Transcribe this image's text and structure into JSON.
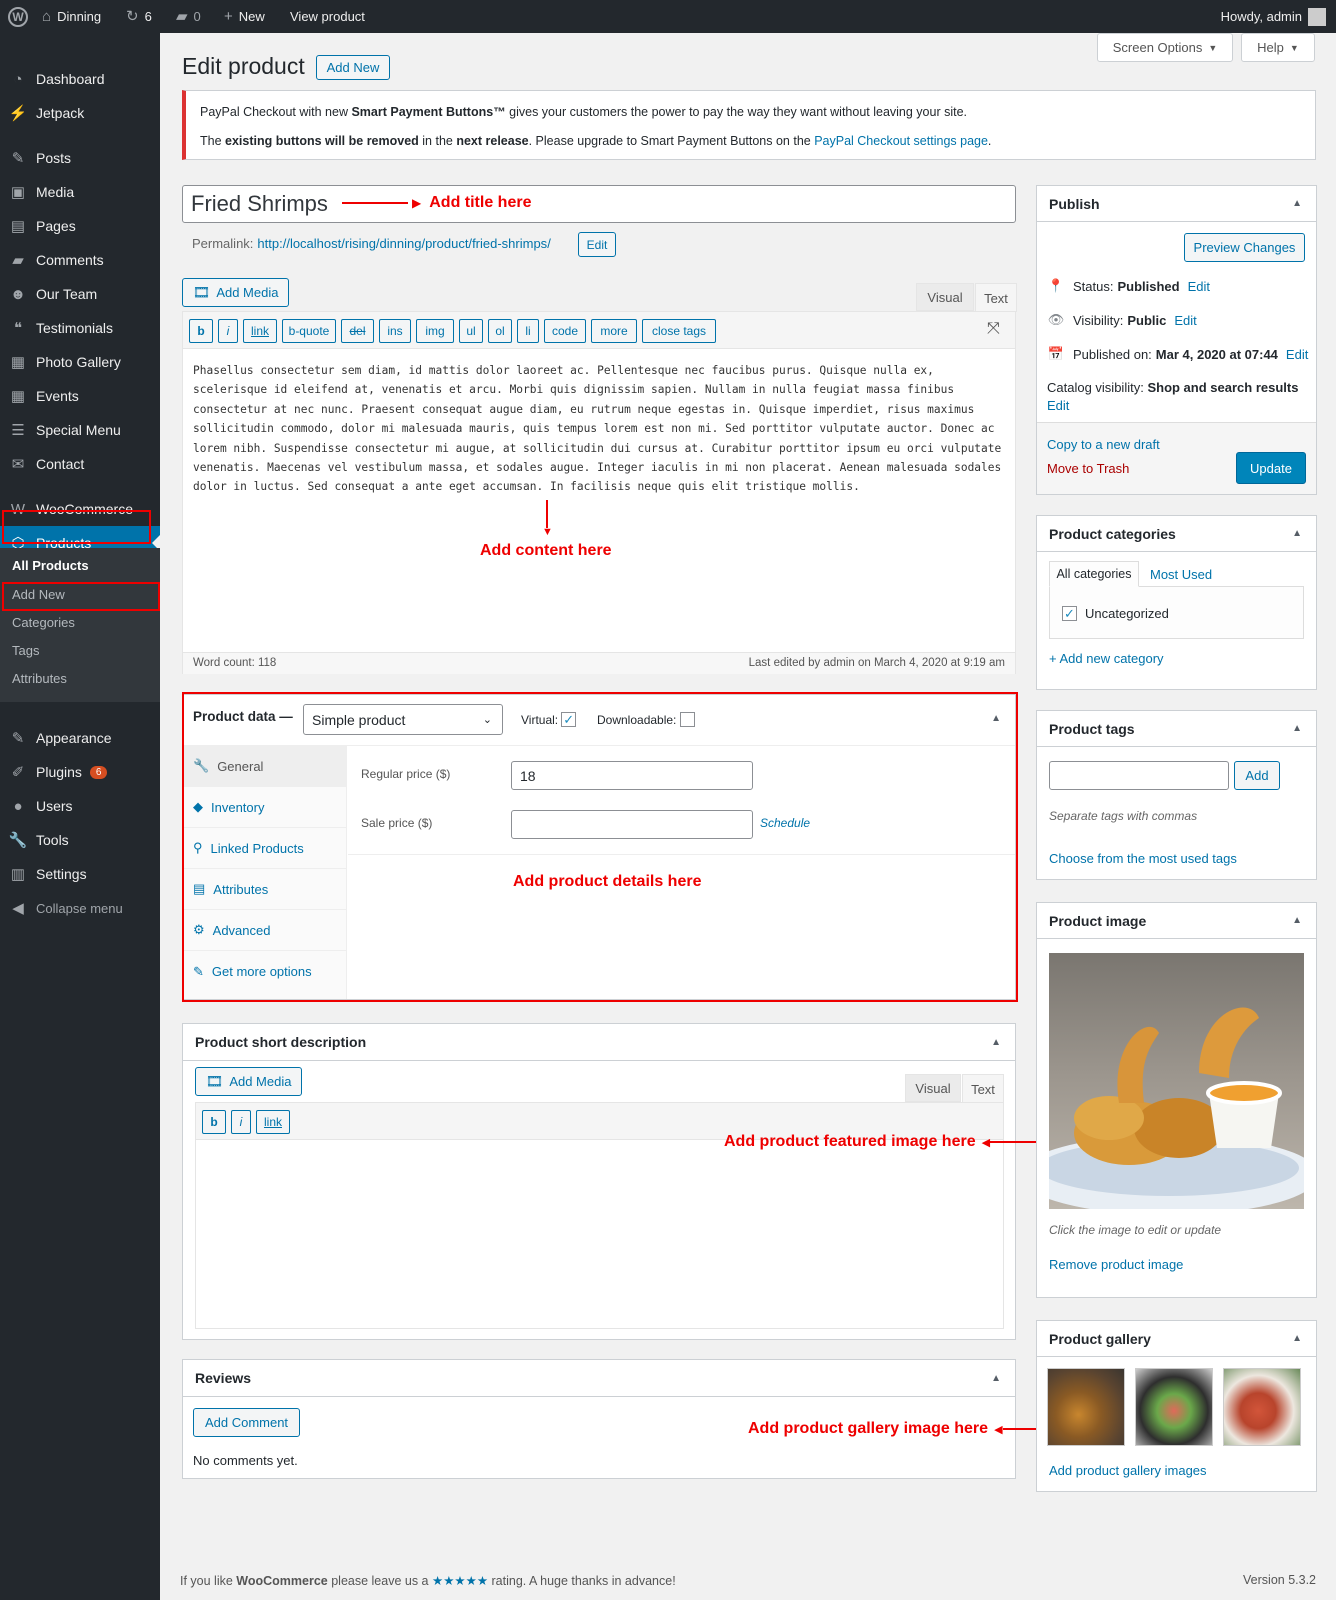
{
  "admin_bar": {
    "site_name": "Dinning",
    "updates_count": "6",
    "comments_count": "0",
    "new_label": "New",
    "view_product": "View product",
    "howdy": "Howdy, admin"
  },
  "sidebar": {
    "items": [
      "Dashboard",
      "Jetpack",
      "Posts",
      "Media",
      "Pages",
      "Comments",
      "Our Team",
      "Testimonials",
      "Photo Gallery",
      "Events",
      "Special Menu",
      "Contact",
      "WooCommerce",
      "Products",
      "Appearance",
      "Plugins",
      "Users",
      "Tools",
      "Settings",
      "Collapse menu"
    ],
    "plugins_badge": "6",
    "submenu": [
      "All Products",
      "Add New",
      "Categories",
      "Tags",
      "Attributes"
    ]
  },
  "header": {
    "screen_options": "Screen Options",
    "help": "Help",
    "page_title": "Edit product",
    "add_new": "Add New"
  },
  "notice": {
    "line1_a": "PayPal Checkout with new ",
    "line1_b": "Smart Payment Buttons™",
    "line1_c": " gives your customers the power to pay the way they want without leaving your site.",
    "line2_a": "The ",
    "line2_b": "existing buttons will be removed",
    "line2_c": " in the ",
    "line2_d": "next release",
    "line2_e": ". Please upgrade to Smart Payment Buttons on the ",
    "line2_link": "PayPal Checkout settings page",
    "line2_f": "."
  },
  "title_field": {
    "value": "Fried Shrimps"
  },
  "permalink": {
    "label": "Permalink:",
    "url_prefix": "http://localhost/rising/dinning/product/",
    "slug": "fried-shrimps",
    "url_suffix": "/",
    "edit": "Edit"
  },
  "editor": {
    "add_media": "Add Media",
    "tab_visual": "Visual",
    "tab_text": "Text",
    "quicktags": [
      "b",
      "i",
      "link",
      "b-quote",
      "del",
      "ins",
      "img",
      "ul",
      "ol",
      "li",
      "code",
      "more",
      "close tags"
    ],
    "content": "Phasellus consectetur sem diam, id mattis dolor laoreet ac. Pellentesque nec faucibus purus. Quisque nulla ex, scelerisque id eleifend at, venenatis et arcu. Morbi quis dignissim sapien. Nullam in nulla feugiat massa finibus consectetur at nec nunc. Praesent consequat augue diam, eu rutrum neque egestas in. Quisque imperdiet, risus maximus sollicitudin commodo, dolor mi malesuada mauris, quis tempus lorem est non mi. Sed porttitor vulputate auctor. Donec ac lorem nibh. Suspendisse consectetur mi augue, at sollicitudin dui cursus at. Curabitur porttitor ipsum eu orci vulputate venenatis. Maecenas vel vestibulum massa, et sodales augue. Integer iaculis in mi non placerat. Aenean malesuada sodales dolor in luctus. Sed consequat a ante eget accumsan. In facilisis neque quis elit tristique mollis.",
    "word_count": "Word count: 118",
    "last_edited": "Last edited by admin on March 4, 2020 at 9:19 am"
  },
  "annotations": {
    "title": "Add title here",
    "content": "Add content here",
    "product_details": "Add product details here",
    "featured_image": "Add product featured image here",
    "gallery": "Add product gallery image here"
  },
  "product_data": {
    "label": "Product data —",
    "type_selected": "Simple product",
    "virtual_label": "Virtual:",
    "virtual_checked": true,
    "downloadable_label": "Downloadable:",
    "downloadable_checked": false,
    "tabs": [
      "General",
      "Inventory",
      "Linked Products",
      "Attributes",
      "Advanced",
      "Get more options"
    ],
    "regular_price_label": "Regular price ($)",
    "regular_price": "18",
    "sale_price_label": "Sale price ($)",
    "sale_price": "",
    "schedule": "Schedule"
  },
  "short_desc": {
    "title": "Product short description",
    "add_media": "Add Media",
    "tab_visual": "Visual",
    "tab_text": "Text",
    "quicktags": [
      "b",
      "i",
      "link"
    ]
  },
  "reviews": {
    "title": "Reviews",
    "add_comment": "Add Comment",
    "empty": "No comments yet."
  },
  "publish": {
    "title": "Publish",
    "preview": "Preview Changes",
    "status_label": "Status:",
    "status": "Published",
    "visibility_label": "Visibility:",
    "visibility": "Public",
    "published_label": "Published on:",
    "published": "Mar 4, 2020 at 07:44",
    "catalog_label": "Catalog visibility:",
    "catalog": "Shop and search results",
    "edit": "Edit",
    "copy_draft": "Copy to a new draft",
    "trash": "Move to Trash",
    "update": "Update"
  },
  "categories": {
    "title": "Product categories",
    "tab_all": "All categories",
    "tab_most": "Most Used",
    "items": [
      {
        "label": "Uncategorized",
        "checked": true
      }
    ],
    "add_new": "+ Add new category"
  },
  "tags": {
    "title": "Product tags",
    "input_value": "",
    "add": "Add",
    "hint": "Separate tags with commas",
    "choose": "Choose from the most used tags"
  },
  "product_image": {
    "title": "Product image",
    "hint": "Click the image to edit or update",
    "remove": "Remove product image"
  },
  "gallery": {
    "title": "Product gallery",
    "add": "Add product gallery images"
  },
  "footer": {
    "text_a": "If you like ",
    "text_b": "WooCommerce",
    "text_c": " please leave us a ",
    "stars": "★★★★★",
    "text_d": " rating. A huge thanks in advance!",
    "version": "Version 5.3.2"
  },
  "colors": {
    "accent": "#0073aa",
    "admin_dark": "#23282d",
    "active_menu": "#0073aa",
    "annotation": "#ee0000",
    "update_button": "#0085ba",
    "badge": "#d54e21"
  }
}
